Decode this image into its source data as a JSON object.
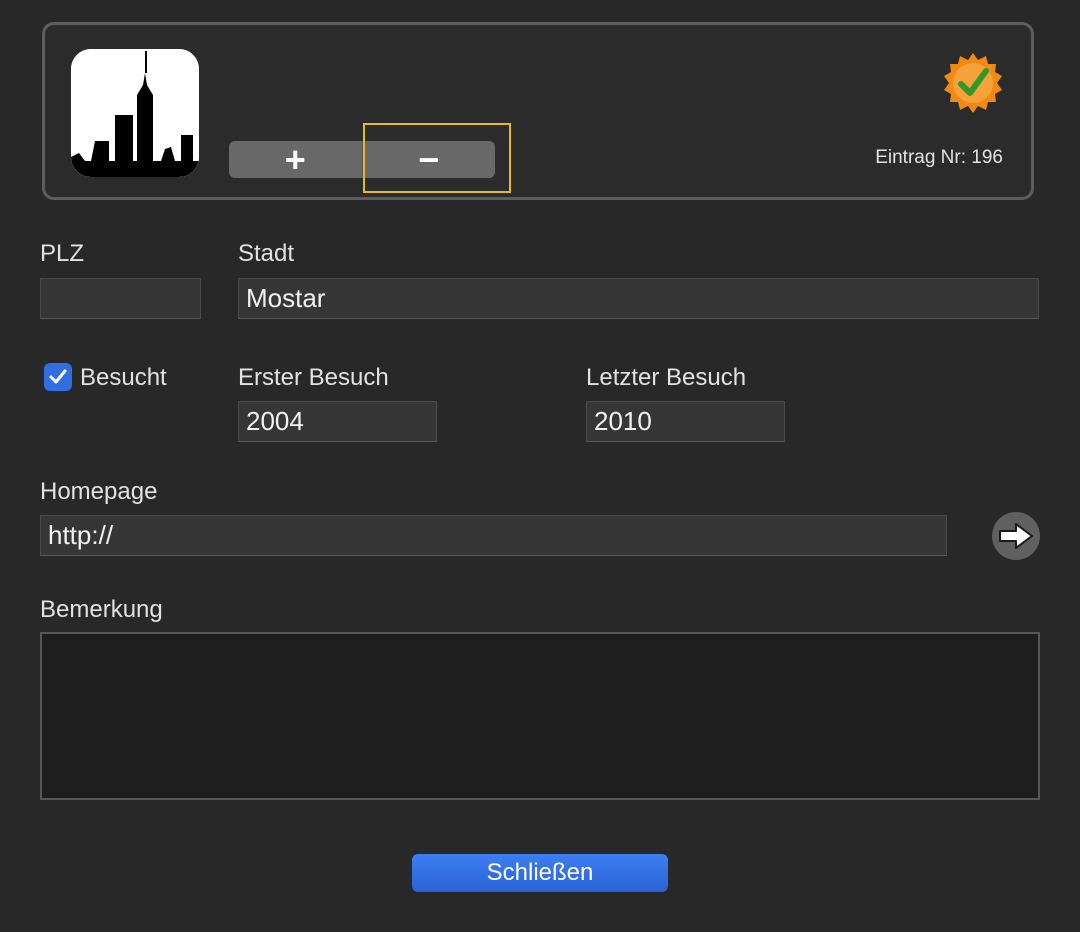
{
  "header": {
    "add_label": "+",
    "remove_label": "−",
    "entry_label": "Eintrag Nr: 196",
    "badge_icon": "verified-badge",
    "accent_badge": "#f08a12"
  },
  "form": {
    "plz": {
      "label": "PLZ",
      "value": ""
    },
    "stadt": {
      "label": "Stadt",
      "value": "Mostar"
    },
    "besucht": {
      "label": "Besucht",
      "checked": true
    },
    "erster_besuch": {
      "label": "Erster Besuch",
      "value": "2004"
    },
    "letzter_besuch": {
      "label": "Letzter Besuch",
      "value": "2010"
    },
    "homepage": {
      "label": "Homepage",
      "value": "http://"
    },
    "bemerkung": {
      "label": "Bemerkung",
      "value": ""
    }
  },
  "footer": {
    "close_label": "Schließen"
  },
  "colors": {
    "background": "#282828",
    "focus_ring": "#e7b82a",
    "primary_button": "#2f6fe0"
  }
}
